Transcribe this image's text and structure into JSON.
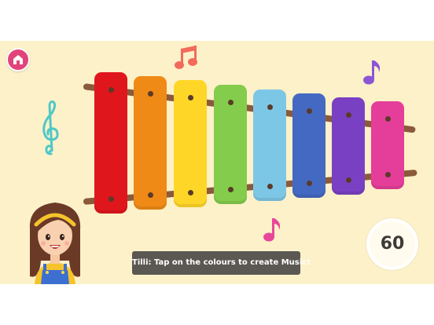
{
  "game": {
    "caption": "Tilli: Tap on the colours to create Music!",
    "timer_value": "60"
  },
  "xylophone": {
    "bar_colors": [
      "#e0161d",
      "#ef8a16",
      "#fed628",
      "#84cc4c",
      "#7dc7e6",
      "#4469c2",
      "#7a40c4",
      "#e43e9a"
    ],
    "rail_color": "#8a5a3b",
    "peg_color": "#5a3a28"
  },
  "decorations": {
    "note_colors": {
      "beamed_note": "#f26b5a",
      "eighth_note_top": "#8b56d6",
      "treble_clef": "#4fc8c8",
      "eighth_note_bottom": "#e8479a"
    }
  },
  "colors": {
    "background": "#fdf1c9",
    "home_button": "#e2447a",
    "caption_bg": "#5b5752"
  }
}
